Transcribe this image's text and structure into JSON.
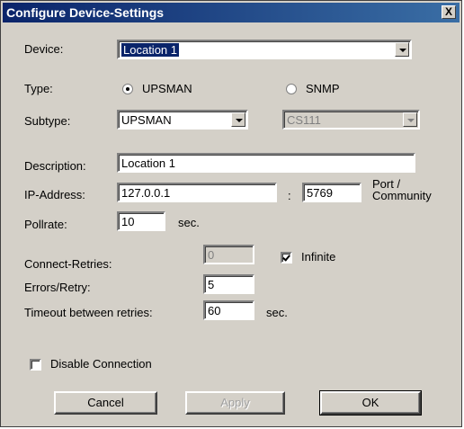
{
  "window": {
    "title": "Configure Device-Settings",
    "close_label": "X"
  },
  "device": {
    "label": "Device:",
    "value": "Location 1"
  },
  "type": {
    "label": "Type:",
    "options": [
      "UPSMAN",
      "SNMP"
    ],
    "selected": "UPSMAN"
  },
  "subtype": {
    "label": "Subtype:",
    "value": "UPSMAN",
    "secondary_value": "CS111"
  },
  "description": {
    "label": "Description:",
    "value": "Location 1"
  },
  "ip": {
    "label": "IP-Address:",
    "value": "127.0.0.1",
    "separator": ":",
    "port_value": "5769",
    "port_label": "Port /",
    "community_label": "Community"
  },
  "pollrate": {
    "label": "Pollrate:",
    "value": "10",
    "unit": "sec."
  },
  "connect_retries": {
    "label": "Connect-Retries:",
    "value": "0",
    "infinite_label": "Infinite",
    "infinite_checked": true
  },
  "errors_retry": {
    "label": "Errors/Retry:",
    "value": "5"
  },
  "timeout": {
    "label": "Timeout between retries:",
    "value": "60",
    "unit": "sec."
  },
  "disable_connection": {
    "label": "Disable Connection",
    "checked": false
  },
  "buttons": {
    "cancel": "Cancel",
    "apply": "Apply",
    "ok": "OK"
  }
}
